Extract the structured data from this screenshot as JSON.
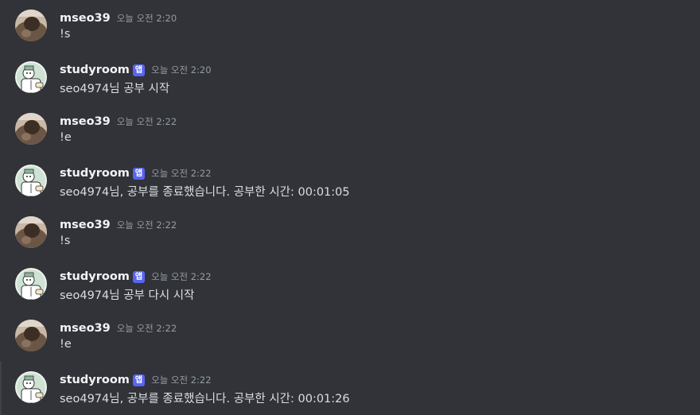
{
  "colors": {
    "background": "#313338",
    "username": "#f2f3f5",
    "timestamp": "#949ba4",
    "text": "#dbdee1",
    "app_badge": "#5865f2"
  },
  "messages": [
    {
      "author": "mseo39",
      "is_app": false,
      "timestamp": "오늘 오전 2:20",
      "content": "!s",
      "avatar": "user-photo-avatar"
    },
    {
      "author": "studyroom",
      "is_app": true,
      "badge": "앱",
      "timestamp": "오늘 오전 2:20",
      "content": "seo4974님 공부 시작",
      "avatar": "bot-cartoon-avatar"
    },
    {
      "author": "mseo39",
      "is_app": false,
      "timestamp": "오늘 오전 2:22",
      "content": "!e",
      "avatar": "user-photo-avatar"
    },
    {
      "author": "studyroom",
      "is_app": true,
      "badge": "앱",
      "timestamp": "오늘 오전 2:22",
      "content": "seo4974님, 공부를 종료했습니다. 공부한 시간: 00:01:05",
      "avatar": "bot-cartoon-avatar"
    },
    {
      "author": "mseo39",
      "is_app": false,
      "timestamp": "오늘 오전 2:22",
      "content": "!s",
      "avatar": "user-photo-avatar"
    },
    {
      "author": "studyroom",
      "is_app": true,
      "badge": "앱",
      "timestamp": "오늘 오전 2:22",
      "content": "seo4974님 공부 다시 시작",
      "avatar": "bot-cartoon-avatar"
    },
    {
      "author": "mseo39",
      "is_app": false,
      "timestamp": "오늘 오전 2:22",
      "content": "!e",
      "avatar": "user-photo-avatar"
    },
    {
      "author": "studyroom",
      "is_app": true,
      "badge": "앱",
      "timestamp": "오늘 오전 2:22",
      "content": "seo4974님, 공부를 종료했습니다. 공부한 시간: 00:01:26",
      "avatar": "bot-cartoon-avatar"
    }
  ]
}
